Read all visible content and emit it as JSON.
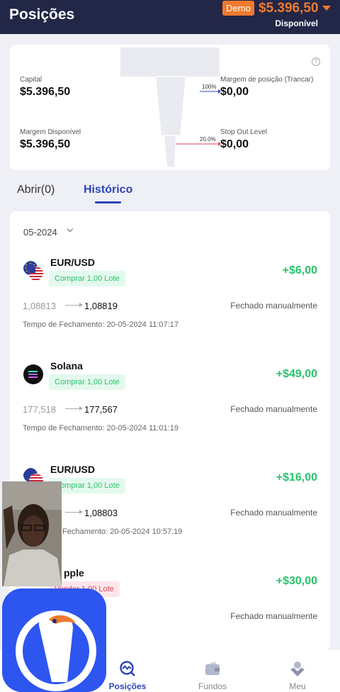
{
  "header": {
    "title": "Posições",
    "demo_badge": "Demo",
    "balance": "$5.396,50",
    "available_label": "Disponível"
  },
  "summary": {
    "capital_label": "Capital",
    "capital_value": "$5.396,50",
    "margin_available_label": "Margem Disponível",
    "margin_available_value": "$5.396,50",
    "position_margin_label": "Margem de posição (Trancar)",
    "position_margin_value": "$0,00",
    "position_margin_pct": "100%",
    "stop_out_label": "Stop Out Level",
    "stop_out_value": "$0,00",
    "stop_out_pct": "20.0%",
    "help_icon": "?"
  },
  "tabs": {
    "open": "Abrir(0)",
    "history": "Histórico"
  },
  "history": {
    "month": "05-2024",
    "trades": [
      {
        "symbol": "EUR/USD",
        "icon": "eu-us-flag-icon",
        "side": "Comprar 1,00 Lote",
        "profit": "+$6,00",
        "open_price": "1,08813",
        "close_price": "1,08819",
        "status": "Fechado manualmente",
        "close_time": "Tempo de Fechamento: 20-05-2024 11:07:17"
      },
      {
        "symbol": "Solana",
        "icon": "solana-icon",
        "side": "Comprar 1,00 Lote",
        "profit": "+$49,00",
        "open_price": "177,518",
        "close_price": "177,567",
        "status": "Fechado manualmente",
        "close_time": "Tempo de Fechamento: 20-05-2024 11:01:19"
      },
      {
        "symbol": "EUR/USD",
        "icon": "eu-us-flag-icon",
        "side": "Comprar 1,00 Lote",
        "profit": "+$16,00",
        "open_price": "",
        "close_price": "1,08803",
        "status": "Fechado manualmente",
        "close_time": "Fechamento: 20-05-2024 10:57:19"
      },
      {
        "symbol": "pple",
        "icon": "apple-icon",
        "side": "Vender 1,00 Lote",
        "profit": "+$30,00",
        "open_price": "",
        "close_price": "",
        "status": "Fechado manualmente",
        "close_time": ""
      }
    ]
  },
  "nav": {
    "positions": "Posições",
    "funds": "Fundos",
    "me": "Meu"
  },
  "colors": {
    "header_bg": "#232747",
    "accent_orange": "#f07a2e",
    "accent_blue": "#2d44b8",
    "profit_green": "#27c46b",
    "sell_red": "#e0475e"
  }
}
